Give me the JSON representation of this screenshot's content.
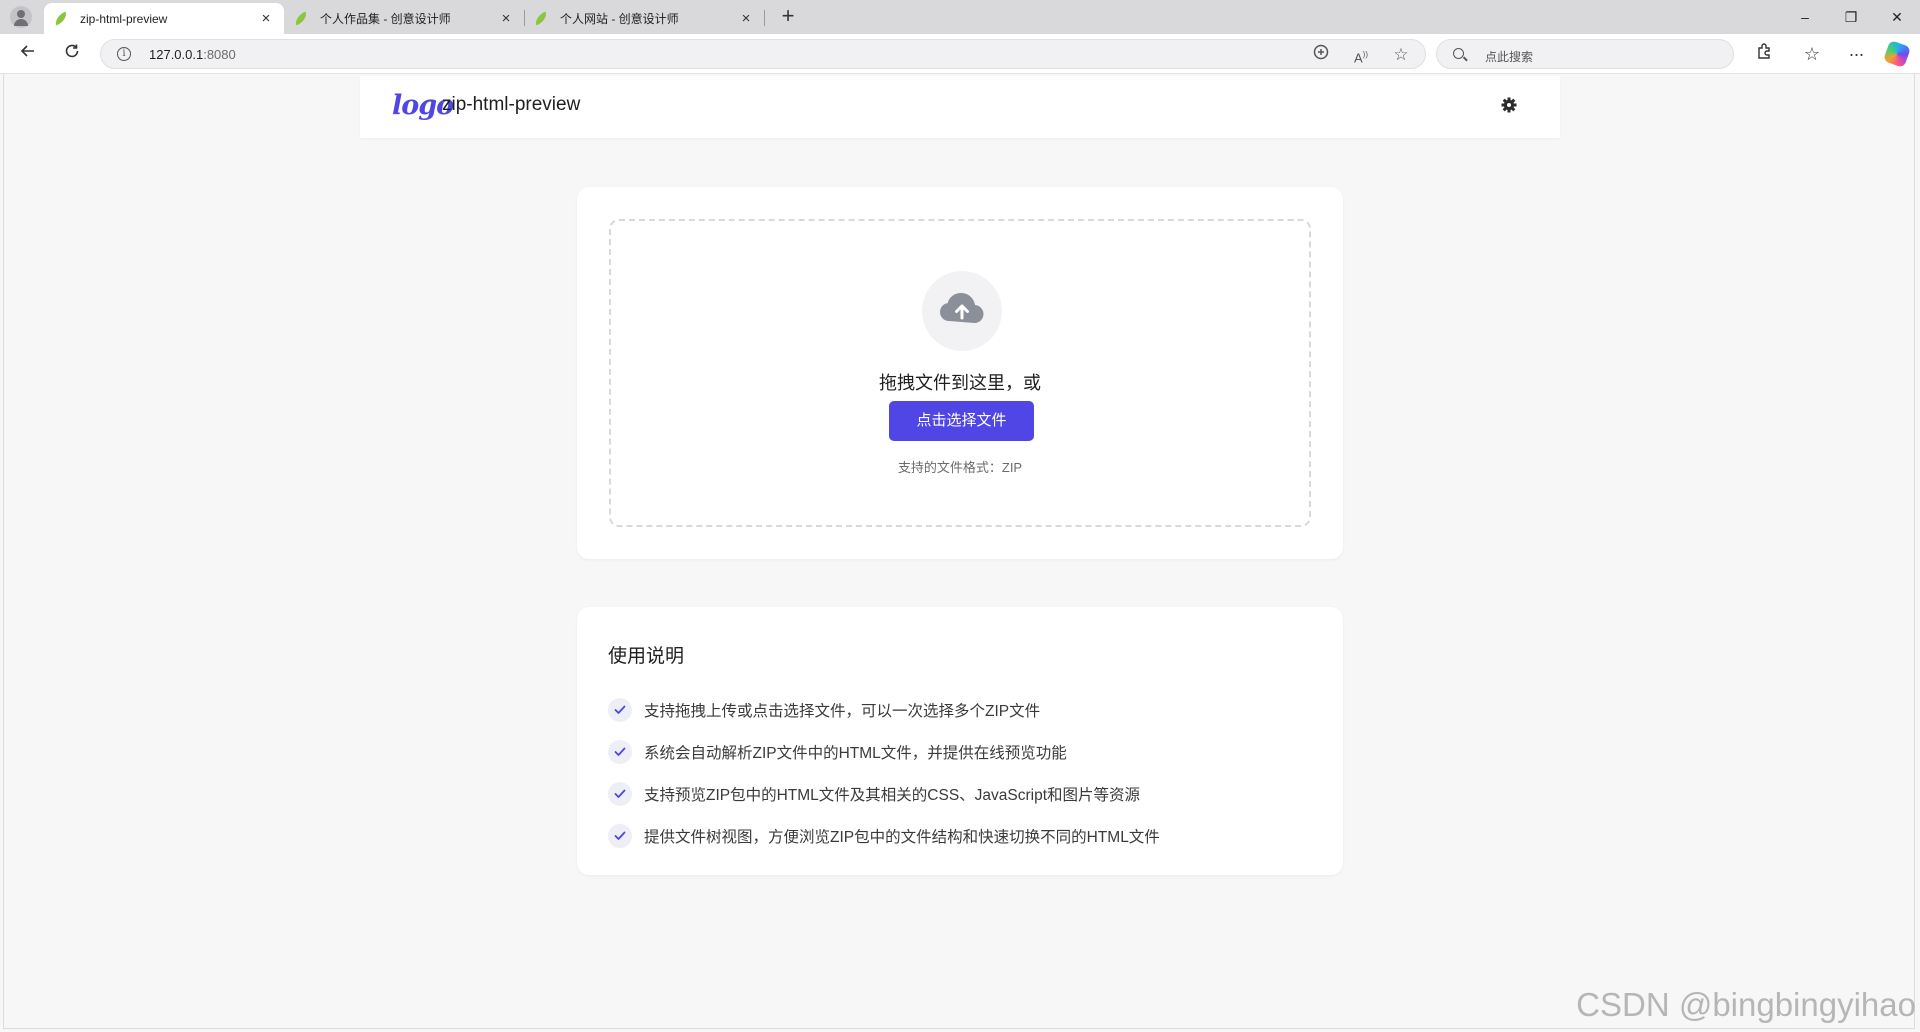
{
  "browser": {
    "tabs": [
      {
        "label": "zip-html-preview",
        "active": true
      },
      {
        "label": "个人作品集 - 创意设计师",
        "active": false
      },
      {
        "label": "个人网站 - 创意设计师",
        "active": false
      }
    ],
    "tab_close_glyph": "×",
    "new_tab_glyph": "+",
    "window_controls": {
      "minimize": "–",
      "restore": "❐",
      "close": "✕"
    },
    "address": {
      "host": "127.0.0.1",
      "port": ":8080"
    },
    "search_placeholder": "点此搜索",
    "icons": [
      "profile-icon",
      "back-icon",
      "reload-icon",
      "info-icon",
      "immersive-reader-icon",
      "read-aloud-icon",
      "favorite-star-icon",
      "search-icon",
      "extensions-icon",
      "favorites-icon",
      "more-icon",
      "copilot-icon"
    ]
  },
  "header": {
    "logo_text": "logo",
    "title": "zip-html-preview",
    "settings_icon": "gear-icon"
  },
  "upload": {
    "icon": "cloud-upload-icon",
    "drop_text": "拖拽文件到这里，或",
    "button_label": "点击选择文件",
    "formats_text": "支持的文件格式：ZIP"
  },
  "guide": {
    "title": "使用说明",
    "items": [
      "支持拖拽上传或点击选择文件，可以一次选择多个ZIP文件",
      "系统会自动解析ZIP文件中的HTML文件，并提供在线预览功能",
      "支持预览ZIP包中的HTML文件及其相关的CSS、JavaScript和图片等资源",
      "提供文件树视图，方便浏览ZIP包中的文件结构和快速切换不同的HTML文件"
    ]
  },
  "watermark": "CSDN @bingbingyihao",
  "colors": {
    "accent": "#4f46e5",
    "page_bg": "#f7f7f8",
    "card_bg": "#ffffff"
  }
}
